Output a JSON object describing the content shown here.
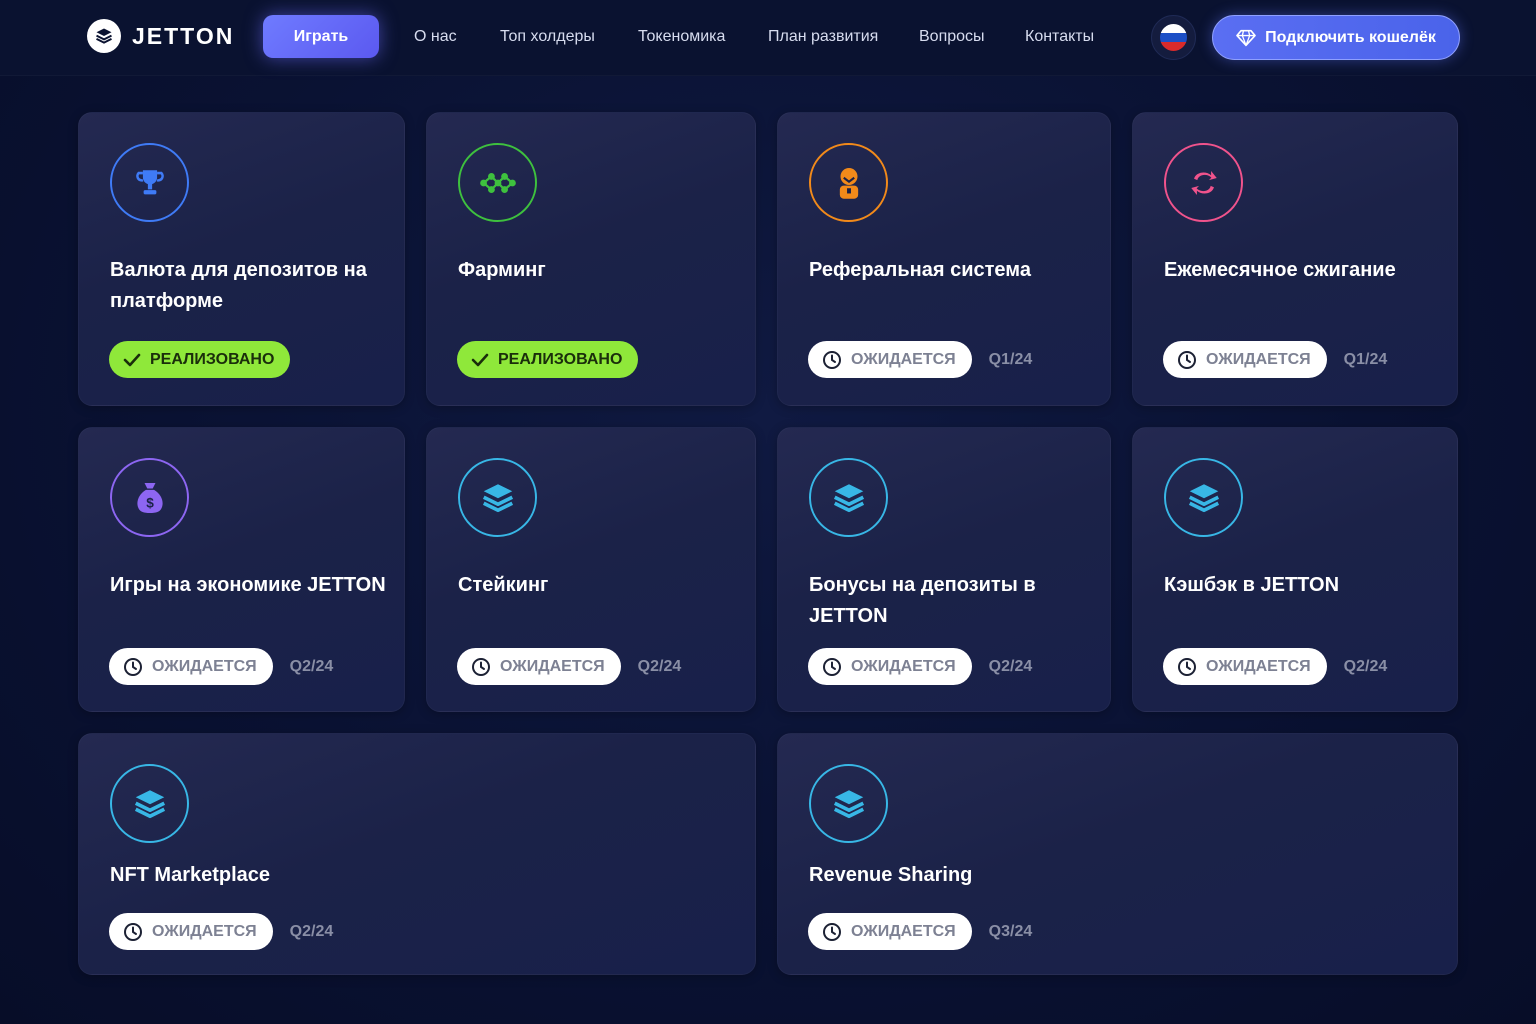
{
  "brand": {
    "name": "JETTON"
  },
  "header": {
    "play_label": "Играть",
    "nav": [
      "О нас",
      "Топ холдеры",
      "Токеномика",
      "План развития",
      "Вопросы",
      "Контакты"
    ],
    "wallet_label": "Подключить кошелёк"
  },
  "colors": {
    "done": "#8fe83a",
    "blue": "#3f7bf6",
    "green": "#3ec13e",
    "orange": "#f28a1a",
    "pink": "#f0538c",
    "purple": "#8d66f2",
    "cyan": "#38b7e6"
  },
  "statuses": {
    "done": "РЕАЛИЗОВАНО",
    "wait": "ОЖИДАЕТСЯ"
  },
  "cards": [
    {
      "title": "Валюта для депозитов на платформе",
      "icon": "trophy-icon",
      "status": "done",
      "quarter": ""
    },
    {
      "title": "Фарминг",
      "icon": "network-icon",
      "status": "done",
      "quarter": ""
    },
    {
      "title": "Реферальная система",
      "icon": "user-icon",
      "status": "wait",
      "quarter": "Q1/24"
    },
    {
      "title": "Ежемесячное сжигание",
      "icon": "refresh-icon",
      "status": "wait",
      "quarter": "Q1/24"
    },
    {
      "title": "Игры на экономике JETTON",
      "icon": "money-bag-icon",
      "status": "wait",
      "quarter": "Q2/24"
    },
    {
      "title": "Стейкинг",
      "icon": "layers-icon",
      "status": "wait",
      "quarter": "Q2/24"
    },
    {
      "title": "Бонусы на депозиты в JETTON",
      "icon": "layers-icon",
      "status": "wait",
      "quarter": "Q2/24"
    },
    {
      "title": "Кэшбэк в JETTON",
      "icon": "layers-icon",
      "status": "wait",
      "quarter": "Q2/24"
    },
    {
      "title": "NFT Marketplace",
      "icon": "layers-icon",
      "status": "wait",
      "quarter": "Q2/24"
    },
    {
      "title": "Revenue Sharing",
      "icon": "layers-icon",
      "status": "wait",
      "quarter": "Q3/24"
    }
  ]
}
